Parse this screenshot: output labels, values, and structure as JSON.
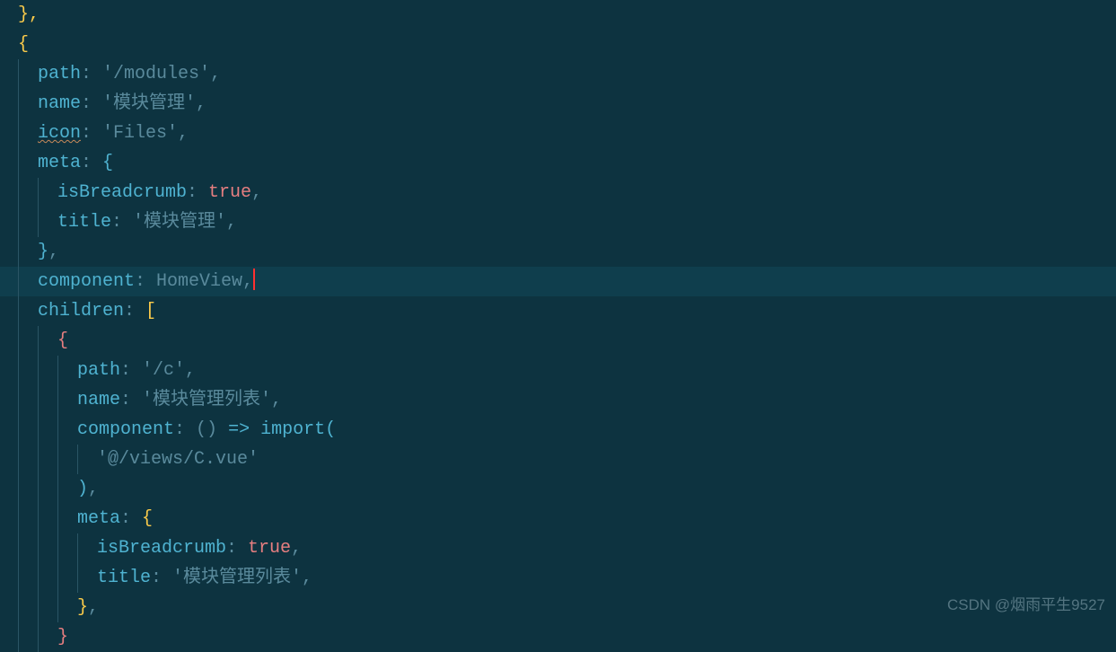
{
  "code": {
    "line1": "},",
    "line2_open": "{",
    "path_key": "path",
    "path_val": "'/modules'",
    "name_key": "name",
    "name_val": "'模块管理'",
    "icon_key": "icon",
    "icon_val": "'Files'",
    "meta_key": "meta",
    "meta_open": "{",
    "isBreadcrumb_key": "isBreadcrumb",
    "isBreadcrumb_val": "true",
    "title_key": "title",
    "title_val": "'模块管理'",
    "meta_close": "}",
    "component_key": "component",
    "component_val": "HomeView",
    "children_key": "children",
    "children_open": "[",
    "child_open": "{",
    "child_path_key": "path",
    "child_path_val": "'/c'",
    "child_name_key": "name",
    "child_name_val": "'模块管理列表'",
    "child_component_key": "component",
    "arrow_open": "() ",
    "arrow": "=>",
    "import_kw": "import",
    "import_open": "(",
    "import_path": "'@/views/C.vue'",
    "import_close": ")",
    "child_meta_key": "meta",
    "child_meta_open": "{",
    "child_isBreadcrumb_key": "isBreadcrumb",
    "child_isBreadcrumb_val": "true",
    "child_title_key": "title",
    "child_title_val": "'模块管理列表'",
    "child_meta_close": "}",
    "child_close": "}",
    "comma": ","
  },
  "watermark": "CSDN @烟雨平生9527"
}
